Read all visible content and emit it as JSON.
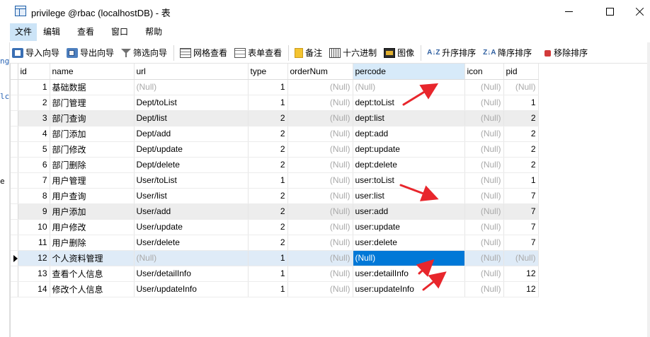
{
  "window": {
    "title": "privilege @rbac (localhostDB) - 表"
  },
  "menu": [
    {
      "label": "文件",
      "active": true
    },
    {
      "label": "编辑"
    },
    {
      "label": "查看"
    },
    {
      "label": "窗口"
    },
    {
      "label": "帮助"
    }
  ],
  "toolbar": {
    "import_wizard": "导入向导",
    "export_wizard": "导出向导",
    "filter_wizard": "筛选向导",
    "grid_view": "网格查看",
    "form_view": "表单查看",
    "memo": "备注",
    "hex": "十六进制",
    "image": "图像",
    "sort_asc": "升序排序",
    "sort_desc": "降序排序",
    "remove_sort": "移除排序",
    "sort_asc_glyph": "A↓Z",
    "sort_desc_glyph": "Z↓A"
  },
  "gutter": [
    "ng",
    "lc",
    "e"
  ],
  "grid": {
    "columns": [
      "id",
      "name",
      "url",
      "type",
      "orderNum",
      "percode",
      "icon",
      "pid"
    ],
    "null_text": "(Null)",
    "rows": [
      [
        "1",
        "基础数据",
        null,
        "1",
        null,
        null,
        null,
        null
      ],
      [
        "2",
        "部门管理",
        "Dept/toList",
        "1",
        null,
        "dept:toList",
        null,
        "1"
      ],
      [
        "3",
        "部门查询",
        "Dept/list",
        "2",
        null,
        "dept:list",
        null,
        "2"
      ],
      [
        "4",
        "部门添加",
        "Dept/add",
        "2",
        null,
        "dept:add",
        null,
        "2"
      ],
      [
        "5",
        "部门修改",
        "Dept/update",
        "2",
        null,
        "dept:update",
        null,
        "2"
      ],
      [
        "6",
        "部门删除",
        "Dept/delete",
        "2",
        null,
        "dept:delete",
        null,
        "2"
      ],
      [
        "7",
        "用户管理",
        "User/toList",
        "1",
        null,
        "user:toList",
        null,
        "1"
      ],
      [
        "8",
        "用户查询",
        "User/list",
        "2",
        null,
        "user:list",
        null,
        "7"
      ],
      [
        "9",
        "用户添加",
        "User/add",
        "2",
        null,
        "user:add",
        null,
        "7"
      ],
      [
        "10",
        "用户修改",
        "User/update",
        "2",
        null,
        "user:update",
        null,
        "7"
      ],
      [
        "11",
        "用户删除",
        "User/delete",
        "2",
        null,
        "user:delete",
        null,
        "7"
      ],
      [
        "12",
        "个人资料管理",
        null,
        "1",
        null,
        null,
        null,
        null
      ],
      [
        "13",
        "查看个人信息",
        "User/detailInfo",
        "1",
        null,
        "user:detailInfo",
        null,
        "12"
      ],
      [
        "14",
        "修改个人信息",
        "User/updateInfo",
        "1",
        null,
        "user:updateInfo",
        null,
        "12"
      ]
    ],
    "alt_rows": [
      3,
      9
    ],
    "selected_row": 12,
    "selected_column": "percode",
    "colors": {
      "selection": "#0078d7",
      "arrow": "#e8262c"
    }
  }
}
